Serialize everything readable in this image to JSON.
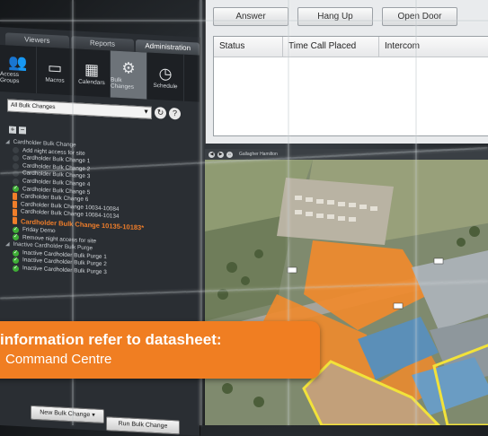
{
  "admin_panel": {
    "tabs": [
      {
        "label": "Viewers"
      },
      {
        "label": "Reports"
      },
      {
        "label": "Administration"
      }
    ],
    "toolbar": [
      {
        "label": "Access Groups",
        "icon": "access-groups-icon",
        "glyph": "👥"
      },
      {
        "label": "Macros",
        "icon": "macros-icon",
        "glyph": "▭"
      },
      {
        "label": "Calendars",
        "icon": "calendar-icon",
        "glyph": "▦"
      },
      {
        "label": "Bulk Changes",
        "icon": "bulk-changes-icon",
        "glyph": "⚙"
      },
      {
        "label": "Schedule",
        "icon": "clock-icon",
        "glyph": "◷"
      }
    ],
    "filter_selected": "All Bulk Changes",
    "tree": {
      "group1": "Cardholder Bulk Change",
      "items1": [
        {
          "label": "Add night access for site",
          "status": "none"
        },
        {
          "label": "Cardholder Bulk Change 1",
          "status": "none"
        },
        {
          "label": "Cardholder Bulk Change 2",
          "status": "none"
        },
        {
          "label": "Cardholder Bulk Change 3",
          "status": "none"
        },
        {
          "label": "Cardholder Bulk Change 4",
          "status": "none"
        },
        {
          "label": "Cardholder Bulk Change 5",
          "status": "ok"
        },
        {
          "label": "Cardholder Bulk Change 6",
          "status": "warn"
        },
        {
          "label": "Cardholder Bulk Change 10034-10084",
          "status": "warn"
        },
        {
          "label": "Cardholder Bulk Change 10084-10134",
          "status": "warn"
        }
      ],
      "highlight": "Cardholder Bulk Change 10135-10183*",
      "items2": [
        {
          "label": "Friday Demo",
          "status": "ok"
        },
        {
          "label": "Remove night access for site",
          "status": "ok"
        }
      ],
      "group2": "Inactive Cardholder Bulk Purge",
      "items3": [
        {
          "label": "Inactive Cardholder Bulk Purge 1",
          "status": "ok"
        },
        {
          "label": "Inactive Cardholder Bulk Purge 2",
          "status": "ok"
        },
        {
          "label": "Inactive Cardholder Bulk Purge 3",
          "status": "ok"
        }
      ]
    },
    "new_button": "New Bulk Change",
    "run_button": "Run Bulk Change"
  },
  "call_window": {
    "buttons": [
      "Answer",
      "Hang Up",
      "Open Door"
    ],
    "columns": [
      "Status",
      "Time Call Placed",
      "Intercom"
    ]
  },
  "map_window": {
    "title": "Gallagher Hamilton"
  },
  "callout": {
    "title": "information refer to datasheet:",
    "subtitle": "Command Centre"
  },
  "colors": {
    "accent": "#f07e22",
    "ok": "#3fae36"
  }
}
